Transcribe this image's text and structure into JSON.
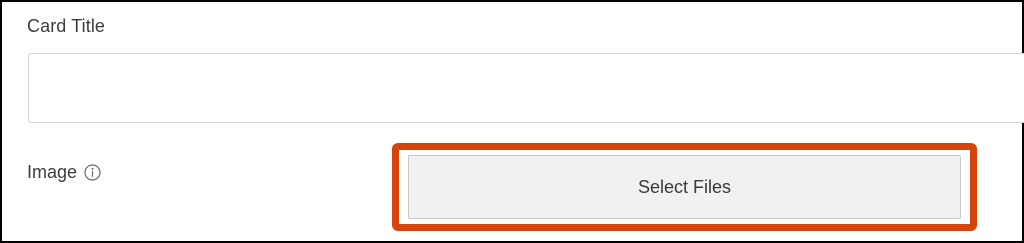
{
  "form": {
    "card_title_label": "Card Title",
    "card_title_value": "",
    "image_label": "Image",
    "info_icon": "info-icon",
    "select_files_label": "Select Files"
  },
  "colors": {
    "highlight": "#d4440b",
    "button_bg": "#f1f1f1",
    "frame_border": "#000000"
  }
}
